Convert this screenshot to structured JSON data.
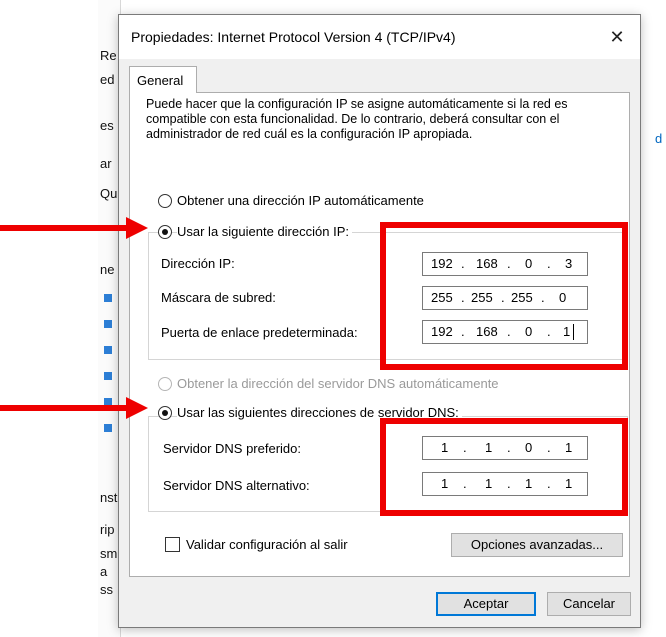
{
  "background": {
    "fragments": [
      "Re",
      "ed",
      "es",
      "ar",
      "Qu",
      "ne",
      "nst",
      "rip",
      "sm",
      "a",
      "ss"
    ],
    "right_fragment": "d"
  },
  "dialog": {
    "title": "Propiedades: Internet Protocol Version 4 (TCP/IPv4)",
    "close_glyph": "✕",
    "tab": "General",
    "description": "Puede hacer que la configuración IP se asigne automáticamente si la red es compatible con esta funcionalidad. De lo contrario, deberá consultar con el administrador de red cuál es la configuración IP apropiada.",
    "ip_auto_label": "Obtener una dirección IP automáticamente",
    "ip_manual_label": "Usar la siguiente dirección IP:",
    "ip_mode": "manual",
    "ip_fields": {
      "ip_label": "Dirección IP:",
      "ip_value": [
        "192",
        "168",
        "0",
        "3"
      ],
      "mask_label": "Máscara de subred:",
      "mask_value": [
        "255",
        "255",
        "255",
        "0"
      ],
      "gateway_label": "Puerta de enlace predeterminada:",
      "gateway_value": [
        "192",
        "168",
        "0",
        "1"
      ]
    },
    "dns_auto_label": "Obtener la dirección del servidor DNS automáticamente",
    "dns_manual_label": "Usar las siguientes direcciones de servidor DNS:",
    "dns_mode": "manual",
    "dns_fields": {
      "preferred_label": "Servidor DNS preferido:",
      "preferred_value": [
        "1",
        "1",
        "0",
        "1"
      ],
      "alternate_label": "Servidor DNS alternativo:",
      "alternate_value": [
        "1",
        "1",
        "1",
        "1"
      ]
    },
    "validate_label": "Validar configuración al salir",
    "validate_checked": false,
    "advanced_button": "Opciones avanzadas...",
    "ok_button": "Aceptar",
    "cancel_button": "Cancelar"
  },
  "colors": {
    "annotation_red": "#ee0000",
    "dialog_bg": "#f0f0f0",
    "default_button_border": "#0078d7"
  }
}
